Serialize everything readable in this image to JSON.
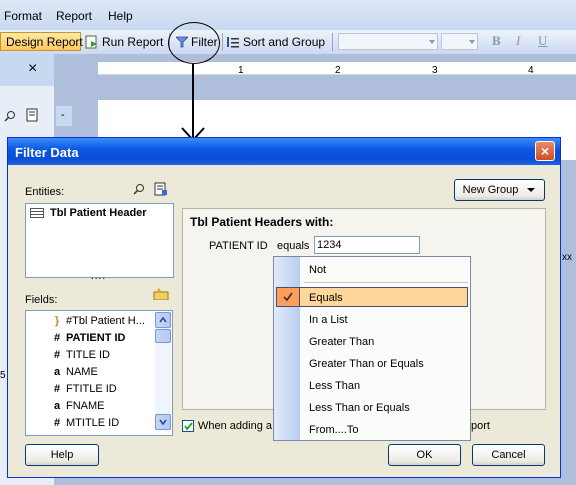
{
  "menu": {
    "format": "Format",
    "report": "Report",
    "help": "Help"
  },
  "toolbar": {
    "design_report": "Design Report",
    "run_report": "Run Report",
    "filter": "Filter",
    "sort_and_group": "Sort and Group",
    "bold": "B",
    "italic": "I",
    "underline": "U"
  },
  "panel": {
    "close_glyph": "×",
    "collapse_glyph": "-"
  },
  "ruler": {
    "ticks": [
      "1",
      "2",
      "3",
      "4"
    ]
  },
  "dialog": {
    "title": "Filter Data",
    "close_glyph": "×",
    "entities_label": "Entities:",
    "entities": [
      "Tbl Patient Header"
    ],
    "splitter": "....",
    "fields_label": "Fields:",
    "fields": [
      {
        "icon": "}",
        "name": "#Tbl Patient H..."
      },
      {
        "icon": "#",
        "name": "PATIENT ID"
      },
      {
        "icon": "#",
        "name": "TITLE ID"
      },
      {
        "icon": "a",
        "name": "NAME"
      },
      {
        "icon": "#",
        "name": "FTITLE ID"
      },
      {
        "icon": "a",
        "name": "FNAME"
      },
      {
        "icon": "#",
        "name": "MTITLE ID"
      }
    ],
    "new_group": "New Group",
    "group_heading": "Tbl Patient Headers with:",
    "condition": {
      "field": "PATIENT ID",
      "operator": "equals",
      "value": "1234"
    },
    "checkbox_label_left": "When adding a",
    "checkbox_label_right": "port",
    "help_button": "Help",
    "ok_button": "OK",
    "cancel_button": "Cancel"
  },
  "operator_menu": {
    "items": [
      "Not",
      "Equals",
      "In a List",
      "Greater Than",
      "Greater Than or Equals",
      "Less Than",
      "Less Than or Equals",
      "From....To"
    ],
    "selected": "Equals"
  },
  "edge_fragments": {
    "right": "xx",
    "left": "5"
  }
}
